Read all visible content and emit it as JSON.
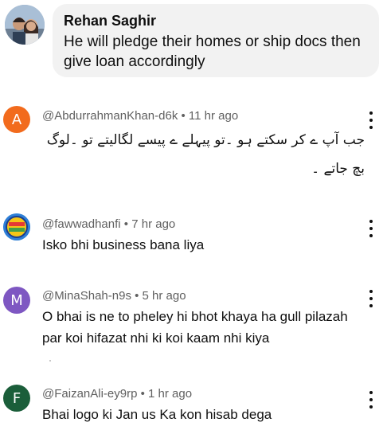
{
  "reply": {
    "author": "Rehan Saghir",
    "text": "He will pledge their homes or ship docs then give loan accordingly"
  },
  "comments": [
    {
      "avatar_letter": "A",
      "avatar_color": "#f26b1d",
      "handle": "@AbdurrahmanKhan-d6k",
      "time": "11 hr ago",
      "text": "جب آپ ے کر سکتے ہو ۔تو پیہلے ے پیسے لگالیتے تو ۔لوگ بچ جاتے ۔"
    },
    {
      "avatar_letter": "",
      "avatar_color": "#2e7fd6",
      "handle": "@fawwadhanfi",
      "time": "7 hr ago",
      "text": "Isko bhi business bana liya"
    },
    {
      "avatar_letter": "M",
      "avatar_color": "#7e57c2",
      "handle": "@MinaShah-n9s",
      "time": "5 hr ago",
      "text": "O bhai is ne to pheley hi bhot khaya ha gull pilazah par koi hifazat nhi ki koi kaam nhi kiya"
    },
    {
      "avatar_letter": "F",
      "avatar_color": "#1b5e3a",
      "handle": "@FaizanAli-ey9rp",
      "time": "1 hr ago",
      "text": "Bhai logo ki Jan us Ka kon hisab dega"
    }
  ],
  "separator": " • "
}
